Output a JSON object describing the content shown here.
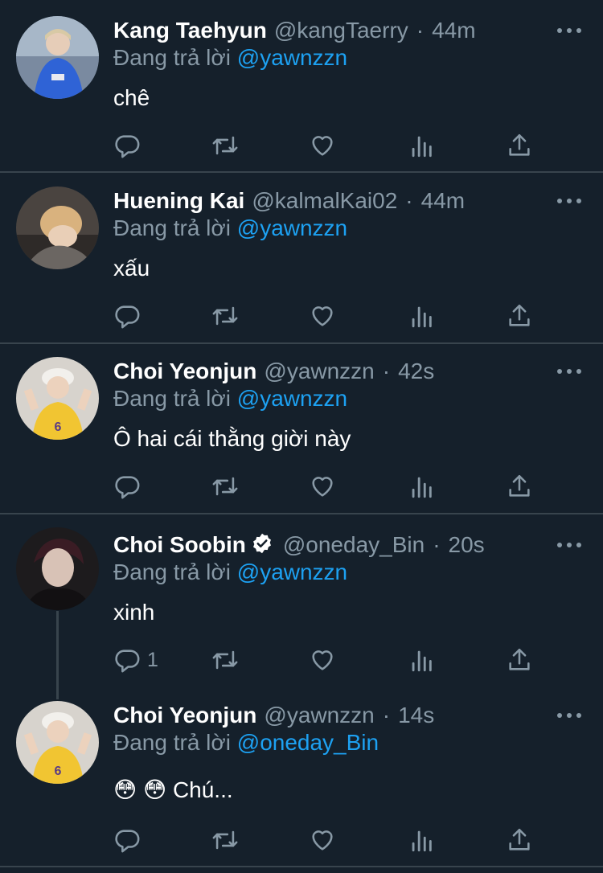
{
  "tweets": [
    {
      "name": "Kang Taehyun",
      "handle": "@kangTaerry",
      "time": "44m",
      "reply_prefix": "Đang trả lời",
      "reply_to": "@yawnzzn",
      "text": "chê",
      "reply_count": ""
    },
    {
      "name": "Huening Kai",
      "handle": "@kalmalKai02",
      "time": "44m",
      "reply_prefix": "Đang trả lời",
      "reply_to": "@yawnzzn",
      "text": "xấu",
      "reply_count": ""
    },
    {
      "name": "Choi Yeonjun",
      "handle": "@yawnzzn",
      "time": "42s",
      "reply_prefix": "Đang trả lời",
      "reply_to": "@yawnzzn",
      "text": "Ô hai cái thằng giời này",
      "reply_count": ""
    },
    {
      "name": "Choi Soobin",
      "handle": "@oneday_Bin",
      "time": "20s",
      "reply_prefix": "Đang trả lời",
      "reply_to": "@yawnzzn",
      "text": "xinh",
      "reply_count": "1",
      "verified": true
    },
    {
      "name": "Choi Yeonjun",
      "handle": "@yawnzzn",
      "time": "14s",
      "reply_prefix": "Đang trả lời",
      "reply_to": "@oneday_Bin",
      "text": "😳 😳  Chú...",
      "reply_count": ""
    }
  ],
  "meta_separator": "·",
  "icons": {
    "reply": "reply-icon",
    "retweet": "retweet-icon",
    "like": "heart-icon",
    "analytics": "analytics-icon",
    "share": "share-icon",
    "more": "more-icon",
    "verified": "verified-badge-icon"
  },
  "colors": {
    "background": "#15202b",
    "muted": "#8899a6",
    "link": "#1da1f2",
    "divider": "#38444d"
  }
}
